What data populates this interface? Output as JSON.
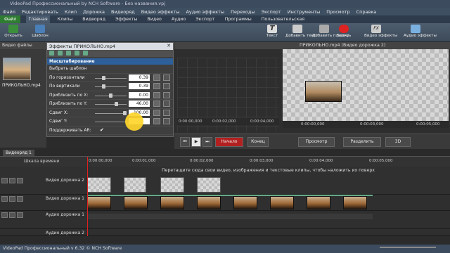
{
  "window": {
    "title": "VideoPad Профессиональный by NCH Software - Без названия.vpj"
  },
  "menu": [
    "Файл",
    "Редактировать",
    "Клип",
    "Дорожка",
    "Видеоряд",
    "Видео эффекты",
    "Аудио эффекты",
    "Переходы",
    "Экспорт",
    "Инструменты",
    "Просмотр",
    "Справка"
  ],
  "tabs": {
    "file": "Файл",
    "items": [
      "Главная",
      "Клипы",
      "Видеоряд",
      "Эффекты",
      "Видео",
      "Аудио",
      "Экспорт",
      "Программы",
      "Пользовательская"
    ]
  },
  "ribbon": {
    "open": "Открыть",
    "save": "Шаблон",
    "text": "Текст",
    "add_text": "Добавить текст",
    "add_plate": "Добавить плашку",
    "record": "Запись",
    "video_fx": "Видео эффекты",
    "audio_fx": "Аудио эффекты"
  },
  "left_panel": {
    "header": "Видео файлы",
    "clip_name": "ПРИКОЛЬНО.mp4"
  },
  "effects_dialog": {
    "title": "Эффекты ПРИКОЛЬНО.mp4",
    "section": "Масштабирование",
    "template": "Выбрать шаблон",
    "rows": [
      {
        "label": "По горизонтали",
        "value": "0.39"
      },
      {
        "label": "По вертикали",
        "value": "0.39"
      },
      {
        "label": "Приблизить по X:",
        "value": "0.00"
      },
      {
        "label": "Приблизить по Y:",
        "value": "46.00"
      },
      {
        "label": "Сдвиг X:",
        "value": "100.00"
      },
      {
        "label": "Сдвиг Y:",
        "value": ""
      }
    ],
    "keep_ar": "Поддерживать AR:"
  },
  "preview": {
    "right_title": "ПРИКОЛЬНО.mp4 (Видео дорожка 2)",
    "left_times": [
      "0:00:00,000",
      "0:00:02,000",
      "0:00:04,000"
    ],
    "right_times": [
      "0:00:00,000",
      "0:00:03,000",
      "0:00:05,000"
    ],
    "start": "Начало",
    "end": "Конец",
    "preview_btn": "Просмотр",
    "split": "Разделить",
    "three_d": "3D"
  },
  "sequence": {
    "tab": "Видеоряд 1",
    "timescale": "Шкала времени",
    "ticks": [
      "0:00:00,000",
      "0:00:01,000",
      "0:00:02,000",
      "0:00:03,000",
      "0:00:04,000",
      "0:00:05,000"
    ]
  },
  "tracks": {
    "video2": "Видео дорожка 2",
    "video1": "Видео дорожка 1",
    "audio1": "Аудио дорожка 1",
    "audio2": "Аудио дорожка 2",
    "drop_note": "Перетащите сюда свои видео, изображения и текстовые клипы, чтобы наложить их поверх"
  },
  "status": "VideoPad Профессиональный v 6.32 © NCH Software"
}
